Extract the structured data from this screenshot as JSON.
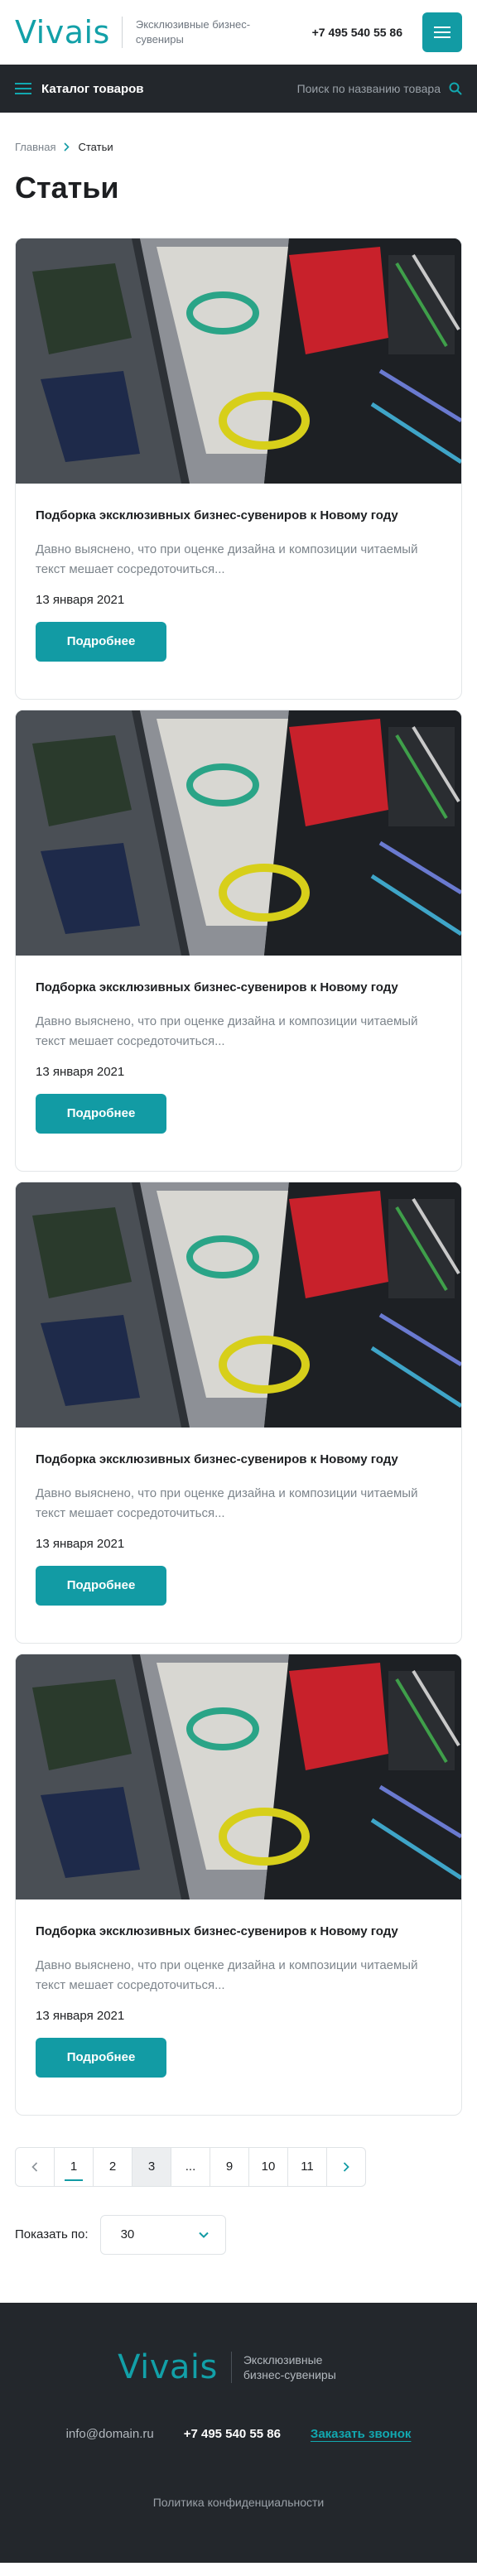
{
  "header": {
    "logo": "Vivais",
    "tagline": "Эксклюзивные бизнес-сувениры",
    "phone": "+7 495 540 55 86"
  },
  "catalog_bar": {
    "label": "Каталог товаров",
    "search_placeholder": "Поиск по названию товара"
  },
  "breadcrumb": {
    "home": "Главная",
    "current": "Статьи"
  },
  "page_title": "Статьи",
  "articles": [
    {
      "title": "Подборка эксклюзивных бизнес-сувениров к Новому году",
      "excerpt": "Давно выяснено, что при оценке дизайна и композиции читаемый текст мешает сосредоточиться...",
      "date": "13 января 2021",
      "button": "Подробнее"
    },
    {
      "title": "Подборка эксклюзивных бизнес-сувениров к Новому году",
      "excerpt": "Давно выяснено, что при оценке дизайна и композиции читаемый текст мешает сосредоточиться...",
      "date": "13 января 2021",
      "button": "Подробнее"
    },
    {
      "title": "Подборка эксклюзивных бизнес-сувениров к Новому году",
      "excerpt": "Давно выяснено, что при оценке дизайна и композиции читаемый текст мешает сосредоточиться...",
      "date": "13 января 2021",
      "button": "Подробнее"
    },
    {
      "title": "Подборка эксклюзивных бизнес-сувениров к Новому году",
      "excerpt": "Давно выяснено, что при оценке дизайна и композиции читаемый текст мешает сосредоточиться...",
      "date": "13 января 2021",
      "button": "Подробнее"
    }
  ],
  "pagination": {
    "pages": [
      "1",
      "2",
      "3",
      "...",
      "9",
      "10",
      "11"
    ],
    "active": "1"
  },
  "per_page": {
    "label": "Показать по:",
    "value": "30"
  },
  "footer": {
    "logo": "Vivais",
    "tagline": "Эксклюзивные бизнес-сувениры",
    "email": "info@domain.ru",
    "phone": "+7 495 540 55 86",
    "callback": "Заказать звонок",
    "policy": "Политика конфиденциальности"
  },
  "colors": {
    "accent": "#129ba4",
    "dark": "#23272c",
    "text": "#1d1f22",
    "muted": "#7d858c"
  }
}
